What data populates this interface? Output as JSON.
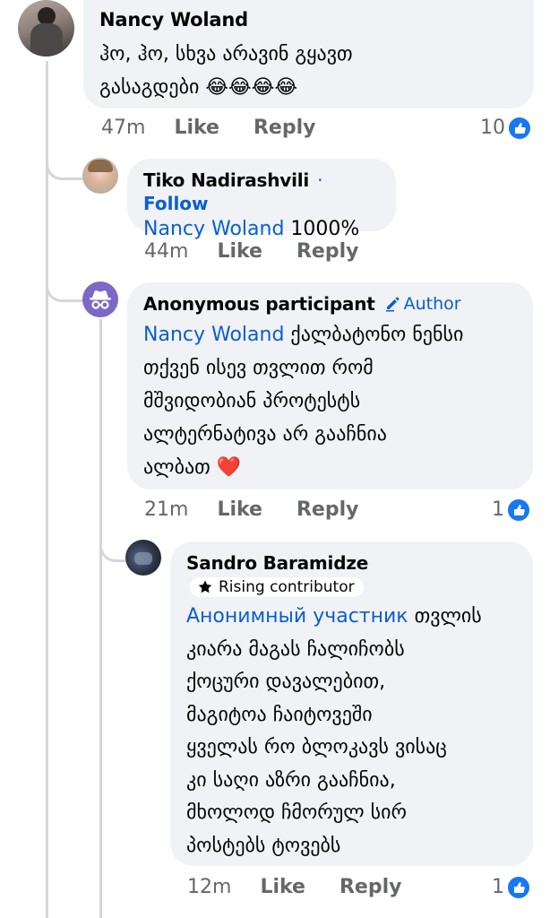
{
  "comments": [
    {
      "author": "Nancy Woland",
      "text": "ჰო, ჰო, სხვა არავინ გყავთ",
      "text_line2": "გასაგდები",
      "emoji": "😂😂😂😂",
      "time": "47m",
      "like_label": "Like",
      "reply_label": "Reply",
      "reaction_count": "10"
    },
    {
      "author": "Tiko Nadirashvili",
      "separator": "·",
      "follow_label": "Follow",
      "mention": "Nancy Woland",
      "text": " 1000%",
      "time": "44m",
      "like_label": "Like",
      "reply_label": "Reply"
    },
    {
      "author": "Anonymous participant",
      "author_badge": "Author",
      "mention": "Nancy Woland",
      "text_lines": [
        " ქალბატონო ნენსი",
        "თქვენ ისევ თვლით რომ",
        "მშვიდობიან პროტესტს",
        "ალტერნატივა არ გააჩნია",
        "ალბათ"
      ],
      "emoji": "❤️",
      "time": "21m",
      "like_label": "Like",
      "reply_label": "Reply",
      "reaction_count": "1"
    },
    {
      "author": "Sandro Baramidze",
      "badge": "Rising contributor",
      "mention": "Анонимный участник",
      "text_lines": [
        " თვლის",
        "კიარა მაგას ჩალიჩობს",
        "ქოცური დავალებით,",
        "მაგიტოა ჩაიტოვეში",
        "ყველას რო ბლოკავს ვისაც",
        "კი საღი აზრი გააჩნია,",
        "მხოლოდ ჩმორულ სირ",
        "პოსტებს ტოვებს"
      ],
      "time": "12m",
      "like_label": "Like",
      "reply_label": "Reply",
      "reaction_count": "1"
    }
  ],
  "icons": {
    "like_reaction": "thumbs-up-icon",
    "anonymous_avatar": "incognito-icon",
    "author_badge": "pencil-icon",
    "rising_badge": "star-icon"
  },
  "colors": {
    "accent": "#0a5ed1",
    "like_badge": "#1877f2",
    "bubble": "#f0f2f5",
    "anon_avatar": "#7b68c8"
  }
}
